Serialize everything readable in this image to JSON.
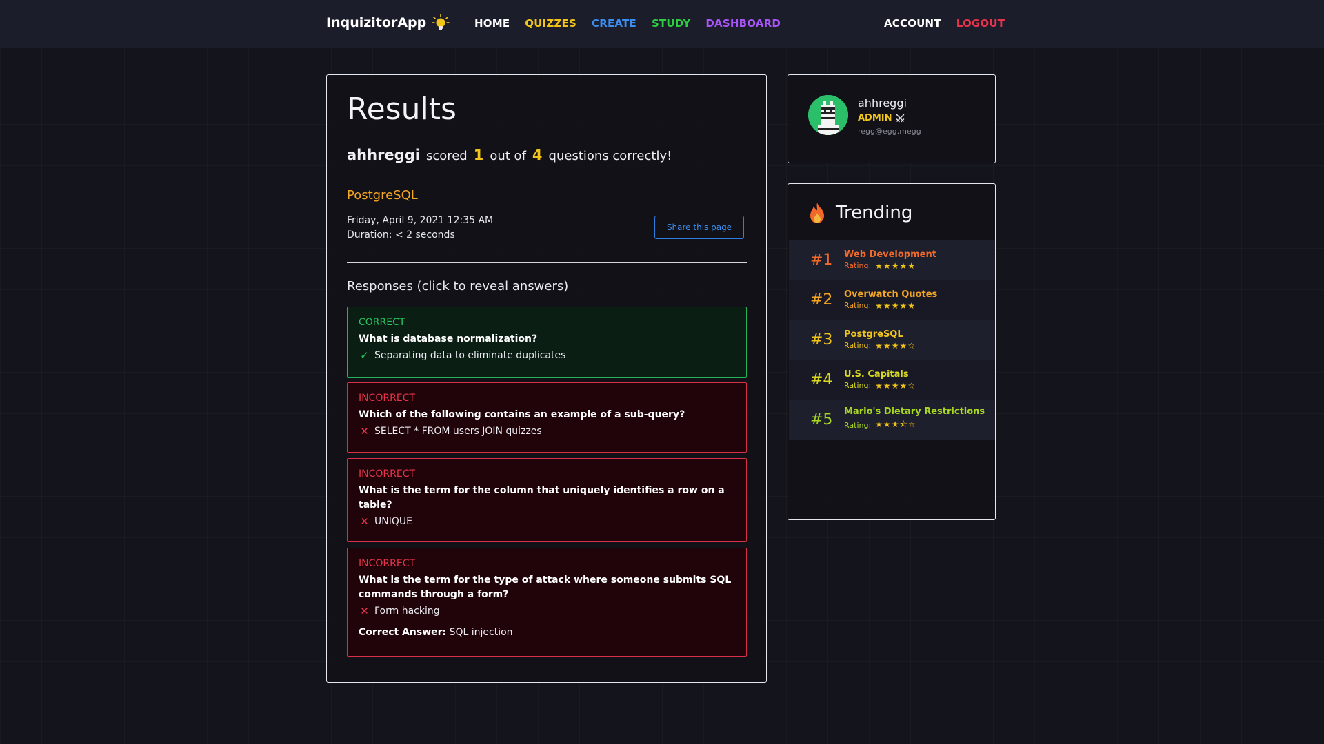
{
  "nav": {
    "brand": "InquizitorApp",
    "links": [
      {
        "label": "HOME",
        "color": "#ffffff"
      },
      {
        "label": "QUIZZES",
        "color": "#f0c419"
      },
      {
        "label": "CREATE",
        "color": "#3b8ef0"
      },
      {
        "label": "STUDY",
        "color": "#2ecc40"
      },
      {
        "label": "DASHBOARD",
        "color": "#a855f7"
      }
    ],
    "account_label": "ACCOUNT",
    "logout_label": "LOGOUT",
    "logout_color": "#e9334c"
  },
  "results": {
    "title": "Results",
    "user": "ahhreggi",
    "scored_text": "scored",
    "score": "1",
    "out_of_text": "out of",
    "total": "4",
    "suffix": "questions correctly!",
    "quiz_name": "PostgreSQL",
    "date": "Friday, April 9, 2021 12:35 AM",
    "duration": "Duration: < 2 seconds",
    "share_label": "Share this page",
    "responses_title": "Responses (click to reveal answers)",
    "responses": [
      {
        "status": "CORRECT",
        "question": "What is database normalization?",
        "answer": "Separating data to eliminate duplicates",
        "icon": "check-icon"
      },
      {
        "status": "INCORRECT",
        "question": "Which of the following contains an example of a sub-query?",
        "answer": "SELECT * FROM users JOIN quizzes",
        "icon": "cross-icon"
      },
      {
        "status": "INCORRECT",
        "question": "What is the term for the column that uniquely identifies a row on a table?",
        "answer": "UNIQUE",
        "icon": "cross-icon"
      },
      {
        "status": "INCORRECT",
        "question": "What is the term for the type of attack where someone submits SQL commands through a form?",
        "answer": "Form hacking",
        "icon": "cross-icon",
        "correct_label": "Correct Answer:",
        "correct_answer": "SQL injection"
      }
    ]
  },
  "profile": {
    "username": "ahhreggi",
    "role": "ADMIN",
    "email": "regg@egg.megg"
  },
  "trending": {
    "title": "Trending",
    "rating_label": "Rating:",
    "items": [
      {
        "rank": "#1",
        "name": "Web Development",
        "rating": 5,
        "stars": "★★★★★",
        "color": "#f06a2c"
      },
      {
        "rank": "#2",
        "name": "Overwatch Quotes",
        "rating": 5,
        "stars": "★★★★★",
        "color": "#f5a623"
      },
      {
        "rank": "#3",
        "name": "PostgreSQL",
        "rating": 4,
        "stars": "★★★★☆",
        "color": "#f0c419"
      },
      {
        "rank": "#4",
        "name": "U.S. Capitals",
        "rating": 4,
        "stars": "★★★★☆",
        "color": "#d8d820"
      },
      {
        "rank": "#5",
        "name": "Mario's Dietary Restrictions",
        "rating": 3.5,
        "stars": "★★★⯪☆",
        "color": "#a8d820"
      }
    ]
  }
}
